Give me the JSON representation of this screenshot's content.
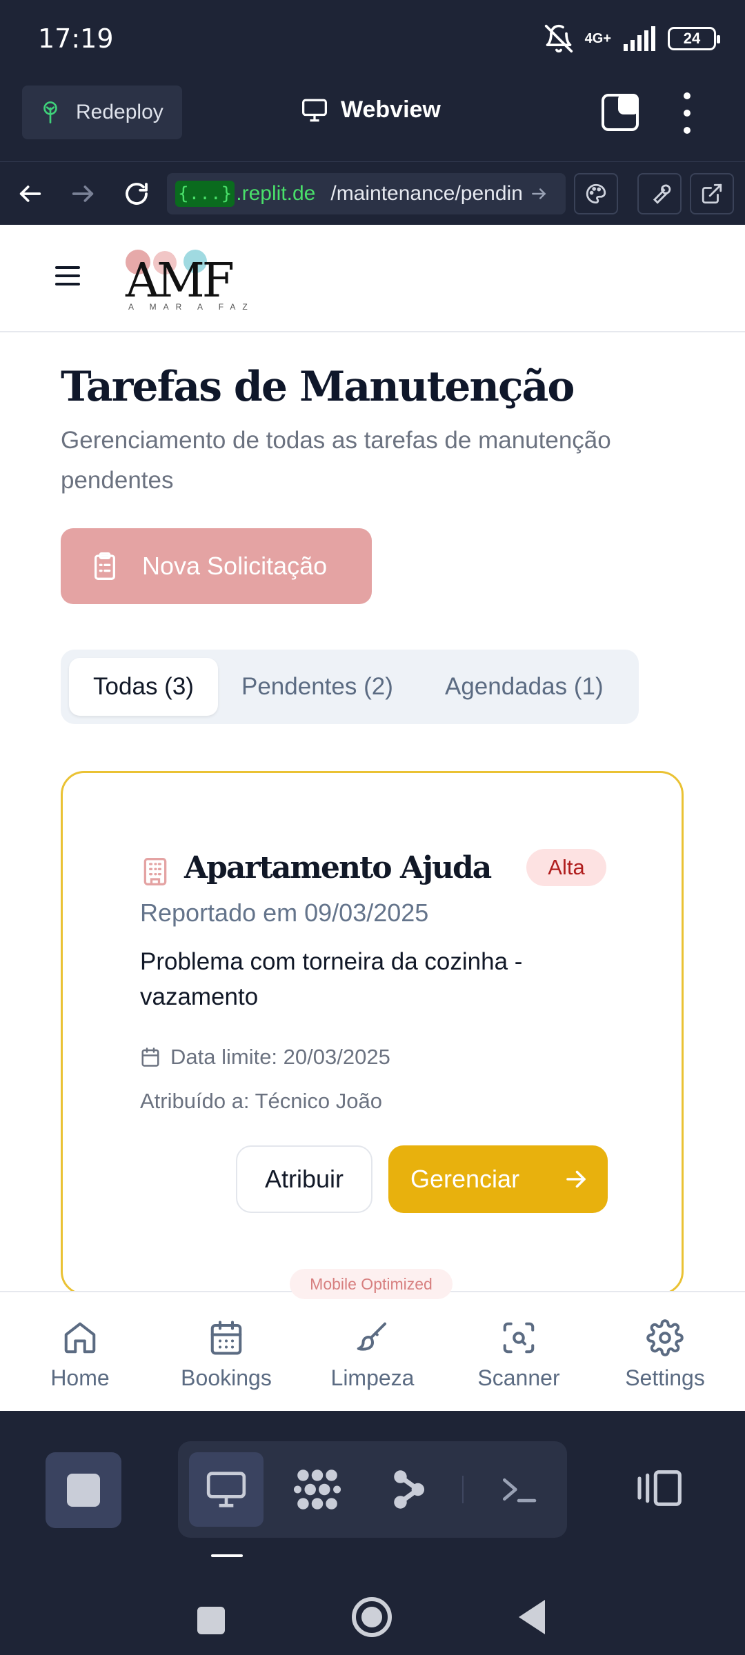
{
  "status_bar": {
    "time": "17:19",
    "network_type": "4G+",
    "battery": "24"
  },
  "replit": {
    "redeploy_label": "Redeploy",
    "webview_title": "Webview",
    "url": {
      "brace": "{...}",
      "host": ".replit.de",
      "path": "/maintenance/pendin"
    },
    "bottom_toolbar_icons": [
      "stop-icon",
      "monitor-icon",
      "grid-icon",
      "git-icon",
      "terminal-icon",
      "side-panel-icon"
    ]
  },
  "app": {
    "logo": {
      "text": "AMF",
      "subtitle": "A MAR A FAZ"
    },
    "page_title": "Tarefas de Manutenção",
    "page_subtitle": "Gerenciamento de todas as tarefas de manutenção pendentes",
    "new_request_label": "Nova Solicitação",
    "filter_tabs": [
      {
        "label": "Todas (3)",
        "active": true
      },
      {
        "label": "Pendentes (2)",
        "active": false
      },
      {
        "label": "Agendadas (1)",
        "active": false
      }
    ],
    "task": {
      "property": "Apartamento Ajuda",
      "priority": "Alta",
      "reported": "Reportado em 09/03/2025",
      "description": "Problema com torneira da cozinha - vazamento",
      "due_date": "Data limite: 20/03/2025",
      "assigned_to": "Atribuído a: Técnico João",
      "assign_label": "Atribuir",
      "manage_label": "Gerenciar"
    },
    "mobile_badge": "Mobile Optimized",
    "bottom_nav": [
      {
        "label": "Home",
        "icon": "home-icon"
      },
      {
        "label": "Bookings",
        "icon": "calendar-icon"
      },
      {
        "label": "Limpeza",
        "icon": "brush-icon"
      },
      {
        "label": "Scanner",
        "icon": "scan-icon"
      },
      {
        "label": "Settings",
        "icon": "gear-icon"
      }
    ]
  },
  "colors": {
    "accent_pink": "#e4a3a3",
    "accent_yellow": "#e8b10d",
    "card_border": "#eac234",
    "priority_high_bg": "#fde2e2",
    "priority_high_text": "#b01e1e",
    "replit_bg": "#1e2436",
    "url_green": "#49e06a"
  }
}
